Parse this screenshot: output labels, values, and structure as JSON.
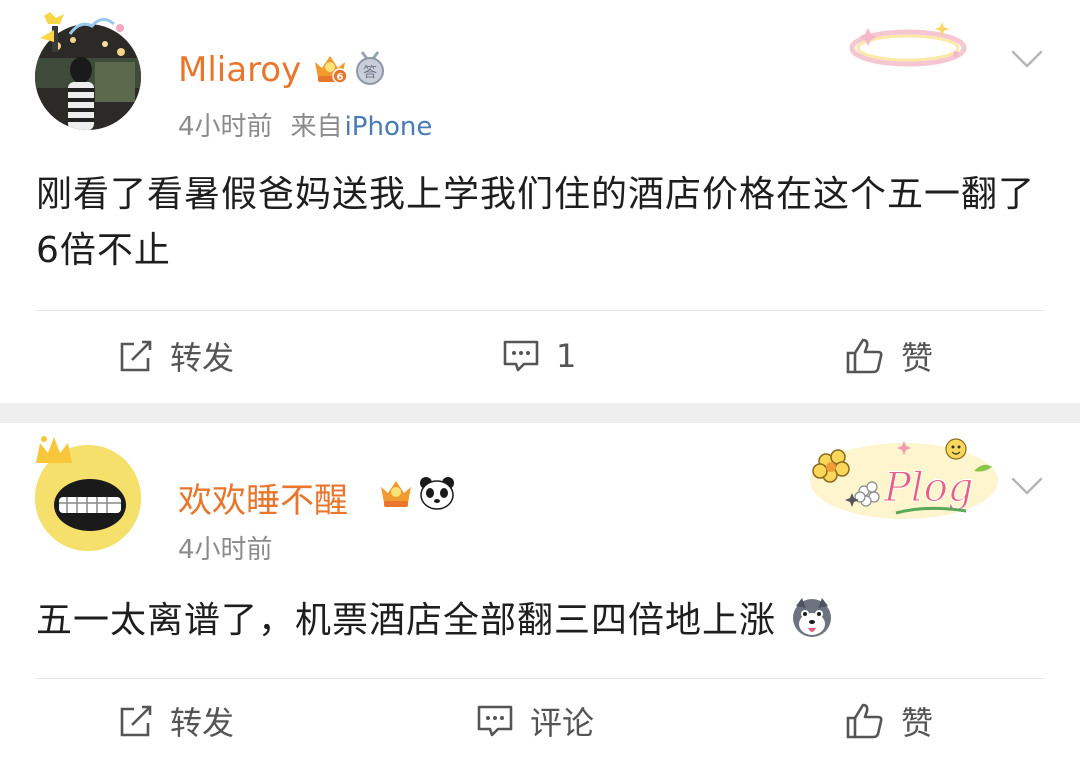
{
  "posts": [
    {
      "username": "Mliaroy",
      "time": "4小时前",
      "source_label": "来自",
      "source_device": "iPhone",
      "content": "刚看了看暑假爸妈送我上学我们住的酒店价格在这个五一翻了6倍不止",
      "badge_vip_level": "6",
      "badge_medal_text": "答",
      "actions": {
        "repost": "转发",
        "comment": "1",
        "like": "赞"
      }
    },
    {
      "username": "欢欢睡不醒",
      "time": "4小时前",
      "content": "五一太离谱了，机票酒店全部翻三四倍地上涨",
      "deco_text": "Plog",
      "actions": {
        "repost": "转发",
        "comment": "评论",
        "like": "赞"
      }
    }
  ],
  "colors": {
    "username": "#e8762d",
    "meta": "#8b8b8b",
    "source_device": "#4a7bb7",
    "separator": "#efefef"
  }
}
